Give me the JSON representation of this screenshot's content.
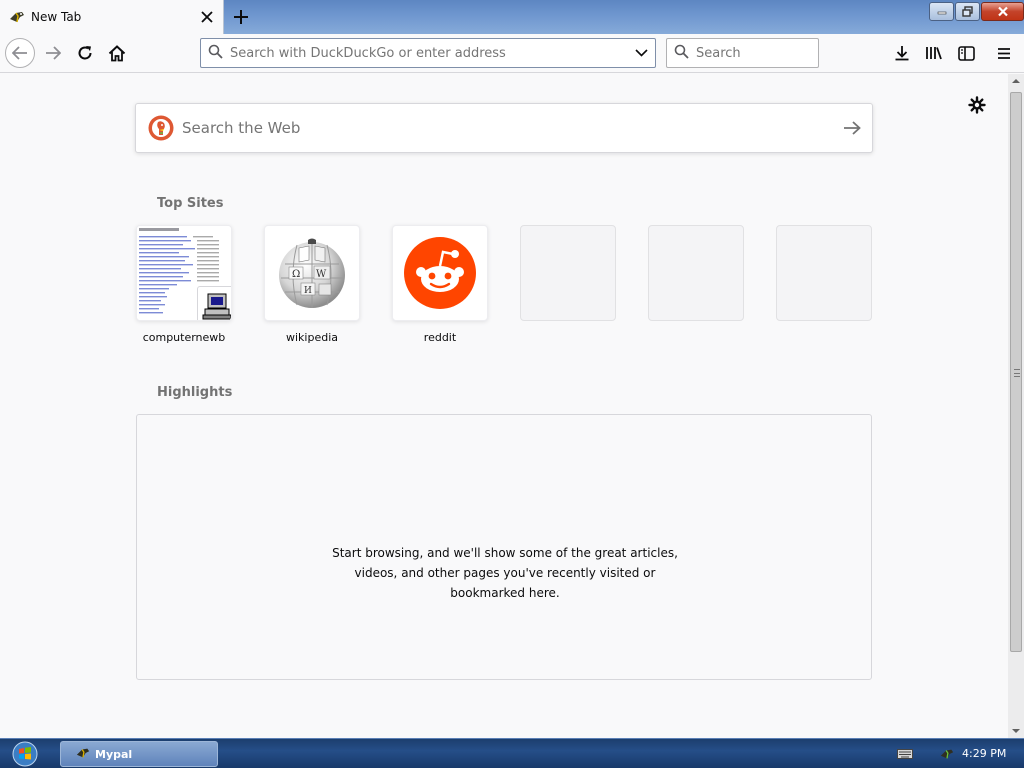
{
  "browser": {
    "tab": {
      "title": "New Tab"
    },
    "address_bar": {
      "placeholder": "Search with DuckDuckGo or enter address"
    },
    "search_bar": {
      "placeholder": "Search"
    }
  },
  "content": {
    "web_search": {
      "placeholder": "Search the Web"
    },
    "top_sites": {
      "title": "Top Sites",
      "tiles": [
        {
          "label": "computernewb"
        },
        {
          "label": "wikipedia"
        },
        {
          "label": "reddit"
        }
      ]
    },
    "highlights": {
      "title": "Highlights",
      "empty_message_lines": [
        "Start browsing, and we'll show some of the great articles,",
        "videos, and other pages you've recently visited or",
        "bookmarked here."
      ]
    }
  },
  "taskbar": {
    "app_label": "Mypal",
    "clock": "4:29 PM"
  },
  "colors": {
    "reddit": "#ff4500",
    "duckduckgo": "#de5833",
    "titlebar": "#6f97cf",
    "taskbar": "#254e88"
  }
}
